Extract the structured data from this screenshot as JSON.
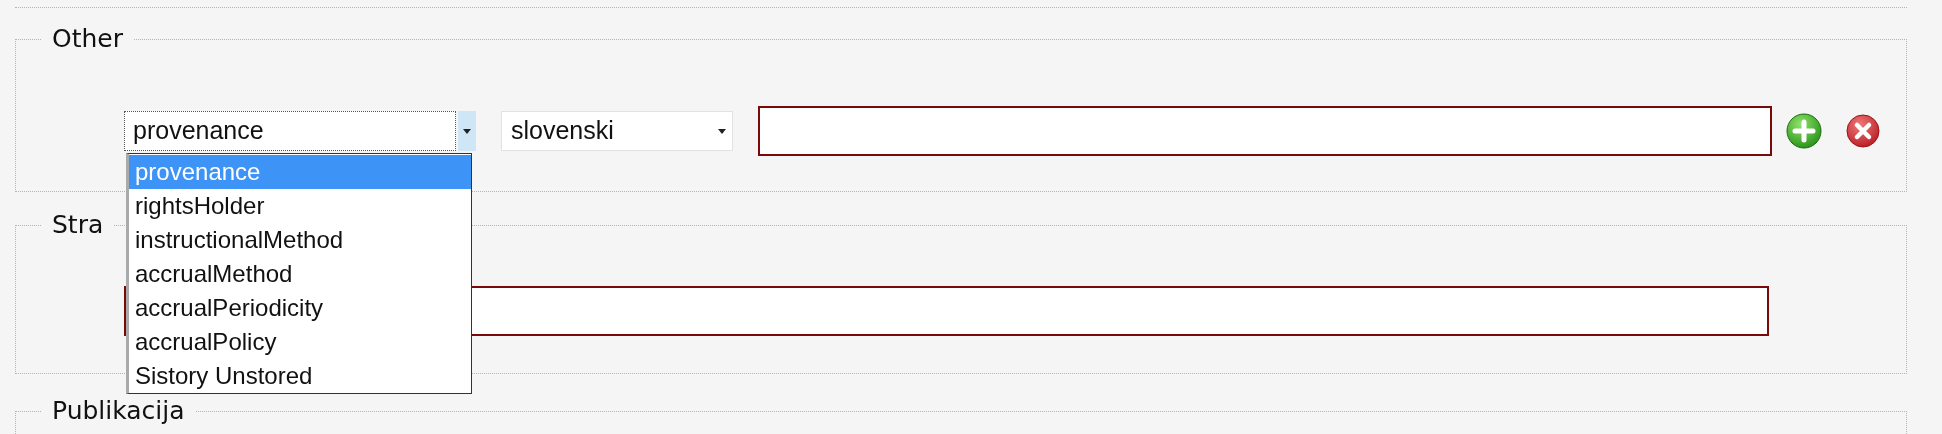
{
  "sections": [
    {
      "legend": "Other",
      "kind": "property",
      "property_select": {
        "value": "provenance",
        "open": true,
        "options": [
          {
            "label": "provenance",
            "selected": true
          },
          {
            "label": "rightsHolder",
            "selected": false
          },
          {
            "label": "instructionalMethod",
            "selected": false
          },
          {
            "label": "accrualMethod",
            "selected": false
          },
          {
            "label": "accrualPeriodicity",
            "selected": false
          },
          {
            "label": "accrualPolicy",
            "selected": false
          },
          {
            "label": "Sistory Unstored",
            "selected": false
          }
        ]
      },
      "language_select": {
        "value": "slovenski"
      }
    },
    {
      "legend": "Stra",
      "kind": "text"
    },
    {
      "legend": "Publikacija",
      "kind": "empty"
    }
  ]
}
